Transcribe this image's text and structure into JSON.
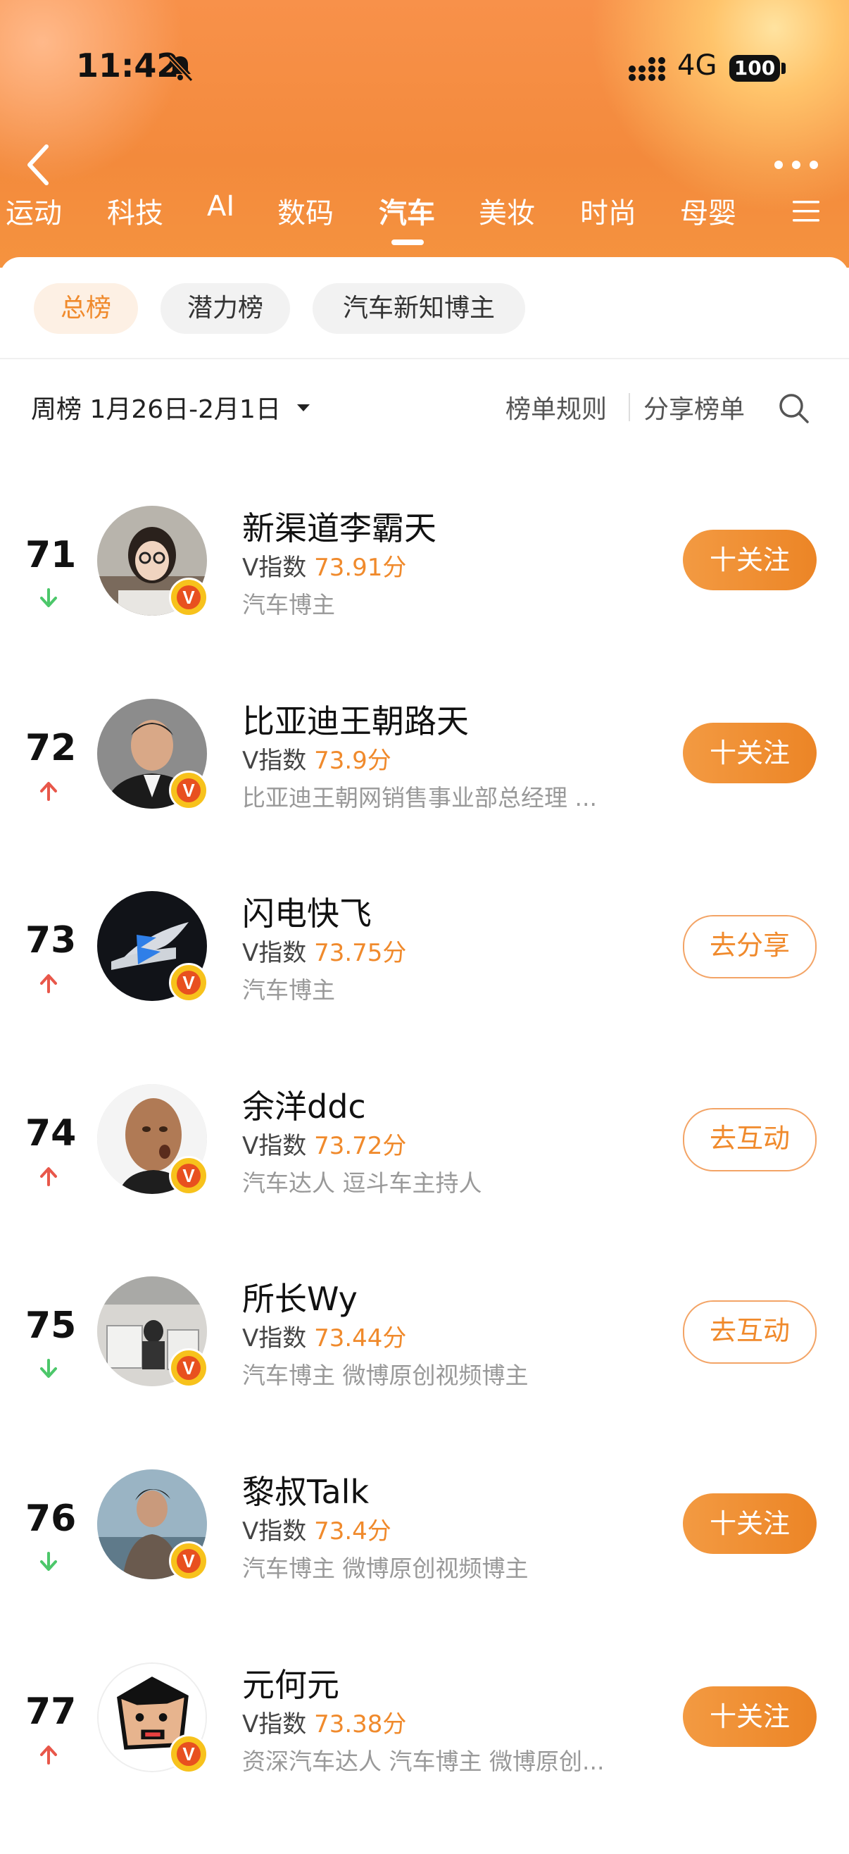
{
  "status_bar": {
    "time": "11:42",
    "network": "4G",
    "battery": "100"
  },
  "tabs": [
    {
      "label": "运动"
    },
    {
      "label": "科技"
    },
    {
      "label": "AI"
    },
    {
      "label": "数码"
    },
    {
      "label": "汽车",
      "active": true
    },
    {
      "label": "美妆"
    },
    {
      "label": "时尚"
    },
    {
      "label": "母婴"
    }
  ],
  "chips": [
    {
      "label": "总榜",
      "active": true
    },
    {
      "label": "潜力榜"
    },
    {
      "label": "汽车新知博主"
    }
  ],
  "toolbar": {
    "week_label": "周榜 1月26日-2月1日",
    "rules": "榜单规则",
    "share": "分享榜单"
  },
  "list": [
    {
      "rank": "71",
      "trend": "down",
      "name": "新渠道李霸天",
      "vindex_label": "V指数",
      "score": "73.91分",
      "desc": "汽车博主",
      "action": "十关注",
      "action_style": "fill"
    },
    {
      "rank": "72",
      "trend": "up",
      "name": "比亚迪王朝路天",
      "vindex_label": "V指数",
      "score": "73.9分",
      "desc": "比亚迪王朝网销售事业部总经理 ...",
      "action": "十关注",
      "action_style": "fill"
    },
    {
      "rank": "73",
      "trend": "up",
      "name": "闪电快飞",
      "vindex_label": "V指数",
      "score": "73.75分",
      "desc": "汽车博主",
      "action": "去分享",
      "action_style": "outline"
    },
    {
      "rank": "74",
      "trend": "up",
      "name": "余洋ddc",
      "vindex_label": "V指数",
      "score": "73.72分",
      "desc": "汽车达人 逗斗车主持人",
      "action": "去互动",
      "action_style": "outline"
    },
    {
      "rank": "75",
      "trend": "down",
      "name": "所长Wy",
      "vindex_label": "V指数",
      "score": "73.44分",
      "desc": "汽车博主 微博原创视频博主",
      "action": "去互动",
      "action_style": "outline"
    },
    {
      "rank": "76",
      "trend": "down",
      "name": "黎叔Talk",
      "vindex_label": "V指数",
      "score": "73.4分",
      "desc": "汽车博主 微博原创视频博主",
      "action": "十关注",
      "action_style": "fill"
    },
    {
      "rank": "77",
      "trend": "up",
      "name": "元何元",
      "vindex_label": "V指数",
      "score": "73.38分",
      "desc": "资深汽车达人 汽车博主 微博原创...",
      "action": "十关注",
      "action_style": "fill"
    }
  ],
  "colors": {
    "accent": "#f08a2c",
    "up": "#e8574a",
    "down": "#4cc76a"
  }
}
